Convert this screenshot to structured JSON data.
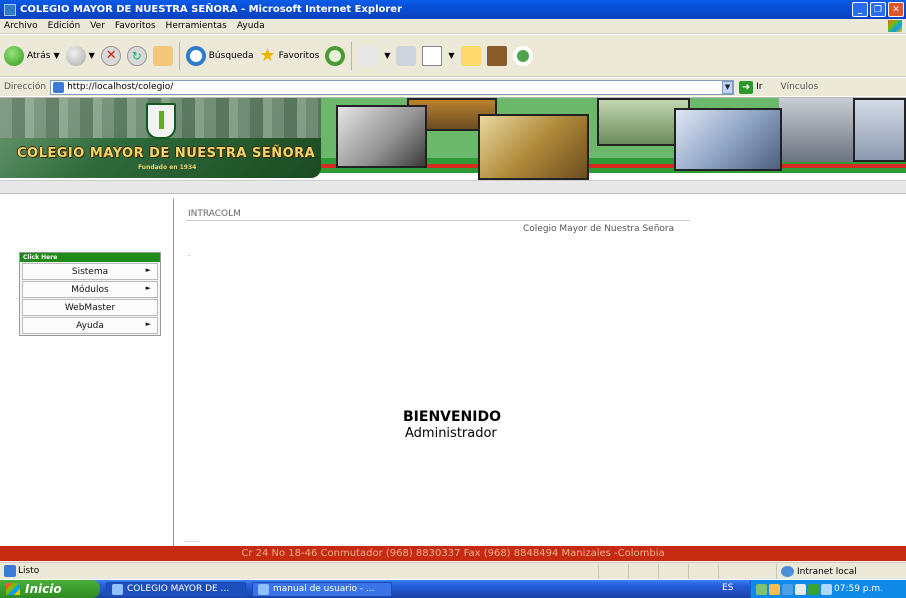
{
  "window": {
    "title": "COLEGIO MAYOR DE NUESTRA SEÑORA - Microsoft Internet Explorer"
  },
  "menubar": {
    "items": [
      "Archivo",
      "Edición",
      "Ver",
      "Favoritos",
      "Herramientas",
      "Ayuda"
    ]
  },
  "toolbar": {
    "back_label": "Atrás",
    "search_label": "Búsqueda",
    "favorites_label": "Favoritos"
  },
  "addressbar": {
    "label": "Dirección",
    "url": "http://localhost/colegio/",
    "go_label": "Ir",
    "links_label": "Vínculos"
  },
  "banner": {
    "title": "COLEGIO MAYOR DE NUESTRA SEÑORA",
    "subtitle": "Fundado en 1934"
  },
  "menu": {
    "header": "Click Here",
    "items": [
      {
        "label": "Sistema",
        "arrow": "►"
      },
      {
        "label": "Módulos",
        "arrow": "►"
      },
      {
        "label": "WebMaster",
        "arrow": ""
      },
      {
        "label": "Ayuda",
        "arrow": "►"
      }
    ]
  },
  "main": {
    "section_title": "INTRACOLM",
    "institution": "Colegio Mayor de Nuestra Señora",
    "welcome": "BIENVENIDO",
    "user": "Administrador"
  },
  "footer": {
    "text": "Cr 24 No 18-46 Conmutador (968) 8830337 Fax (968) 8848494 Manizales -Colombia"
  },
  "statusbar": {
    "status": "Listo",
    "zone": "Intranet local"
  },
  "taskbar": {
    "start_label": "Inicio",
    "tasks": [
      "COLEGIO MAYOR DE ...",
      "manual de usuario - ..."
    ],
    "lang": "ES",
    "clock": "07:59 p.m."
  },
  "colors": {
    "title_bar": "#0a5de8",
    "menu_header": "#1f8a17",
    "footer": "#c62a10",
    "start_button": "#3a9a2e"
  }
}
